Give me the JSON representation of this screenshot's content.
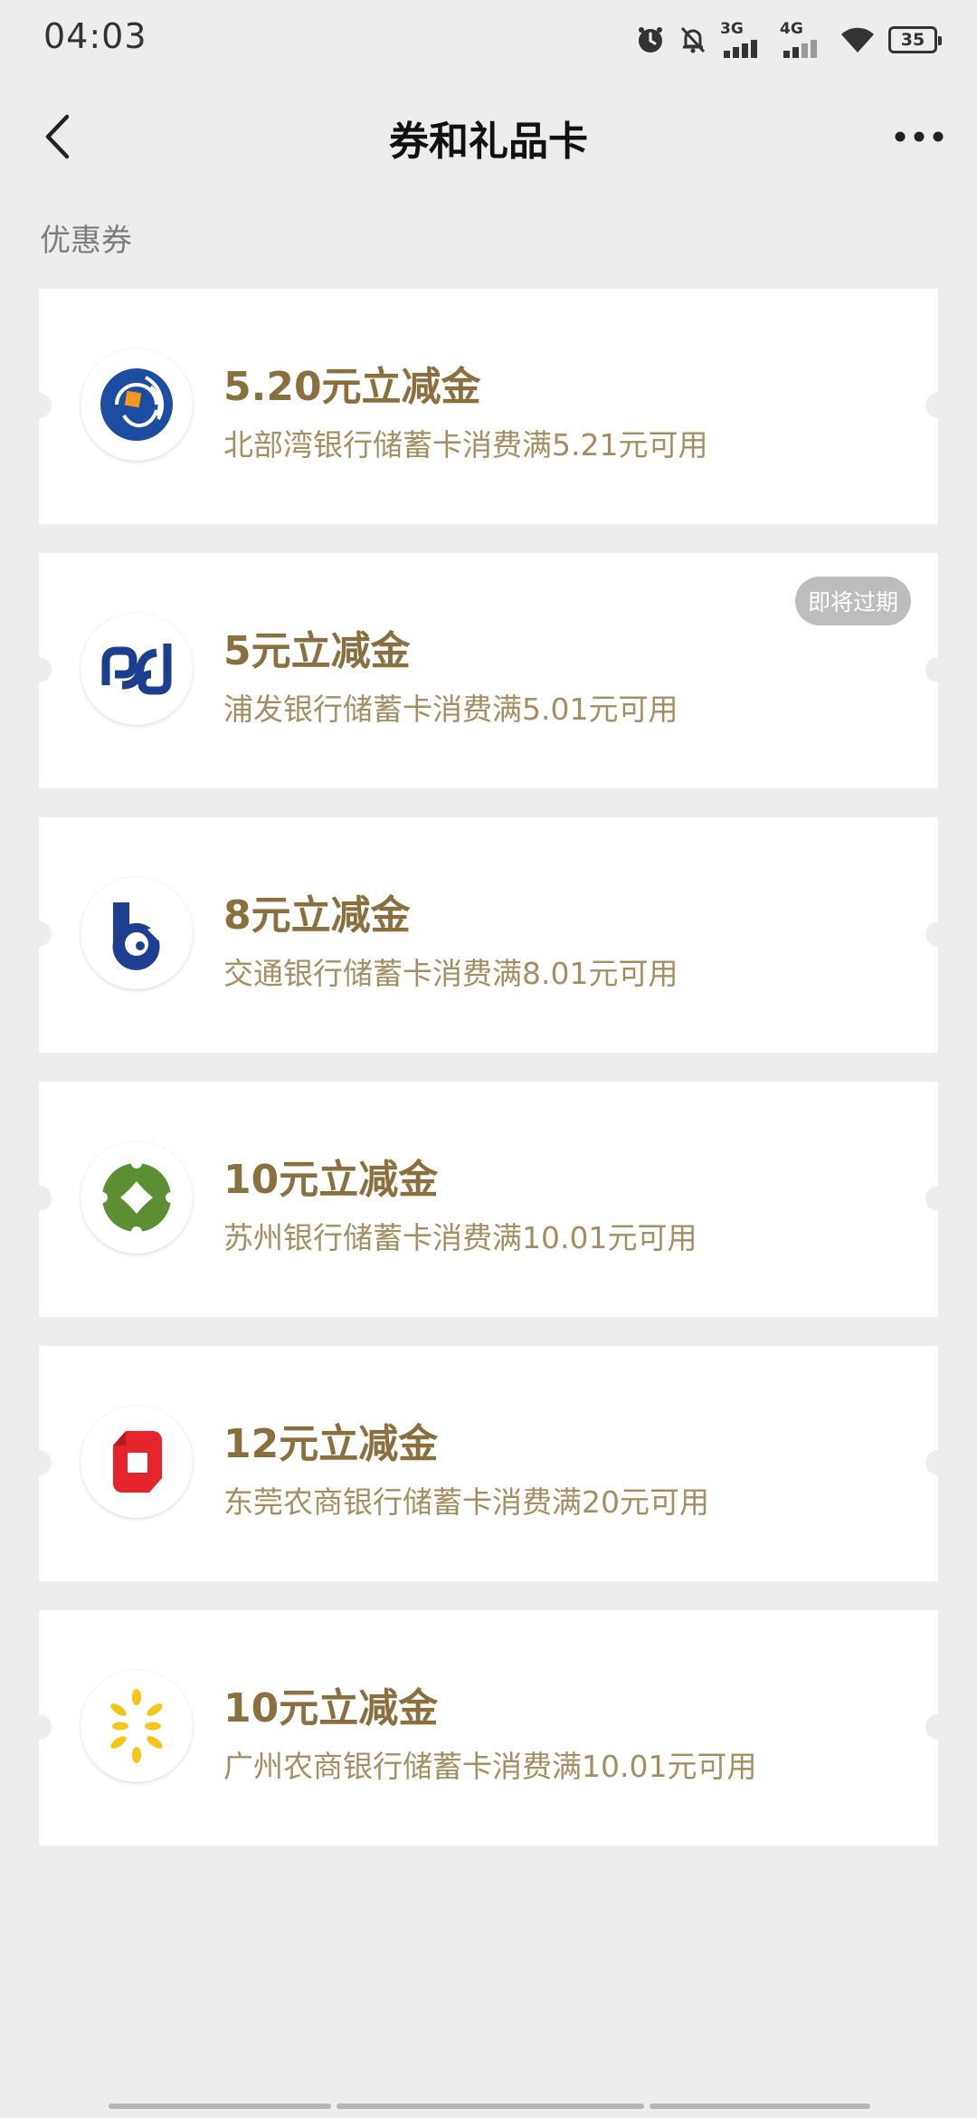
{
  "status_bar": {
    "time": "04:03",
    "network_1": "3G",
    "network_2": "4G",
    "battery": "35",
    "icons": [
      "alarm-icon",
      "mute-bell-icon",
      "signal-3g-icon",
      "signal-4g-icon",
      "wifi-icon",
      "battery-icon"
    ]
  },
  "nav": {
    "title": "券和礼品卡",
    "back_icon": "chevron-left-icon",
    "more_icon": "more-dots-icon"
  },
  "section_label": "优惠券",
  "coupons": [
    {
      "title": "5.20元立减金",
      "desc": "北部湾银行储蓄卡消费满5.21元可用",
      "logo": "beibu-gulf-bank-logo"
    },
    {
      "title": "5元立减金",
      "desc": "浦发银行储蓄卡消费满5.01元可用",
      "logo": "spd-bank-logo",
      "badge": "即将过期"
    },
    {
      "title": "8元立减金",
      "desc": "交通银行储蓄卡消费满8.01元可用",
      "logo": "bank-of-communications-logo"
    },
    {
      "title": "10元立减金",
      "desc": "苏州银行储蓄卡消费满10.01元可用",
      "logo": "bank-of-suzhou-logo"
    },
    {
      "title": "12元立减金",
      "desc": "东莞农商银行储蓄卡消费满20元可用",
      "logo": "dongguan-rural-bank-logo"
    },
    {
      "title": "10元立减金",
      "desc": "广州农商银行储蓄卡消费满10.01元可用",
      "logo": "guangzhou-rural-bank-logo"
    }
  ],
  "colors": {
    "background": "#ededed",
    "card": "#ffffff",
    "title_gold": "#8a703f",
    "desc_gold": "#a48f63",
    "badge_gray": "#bdbdbd"
  }
}
